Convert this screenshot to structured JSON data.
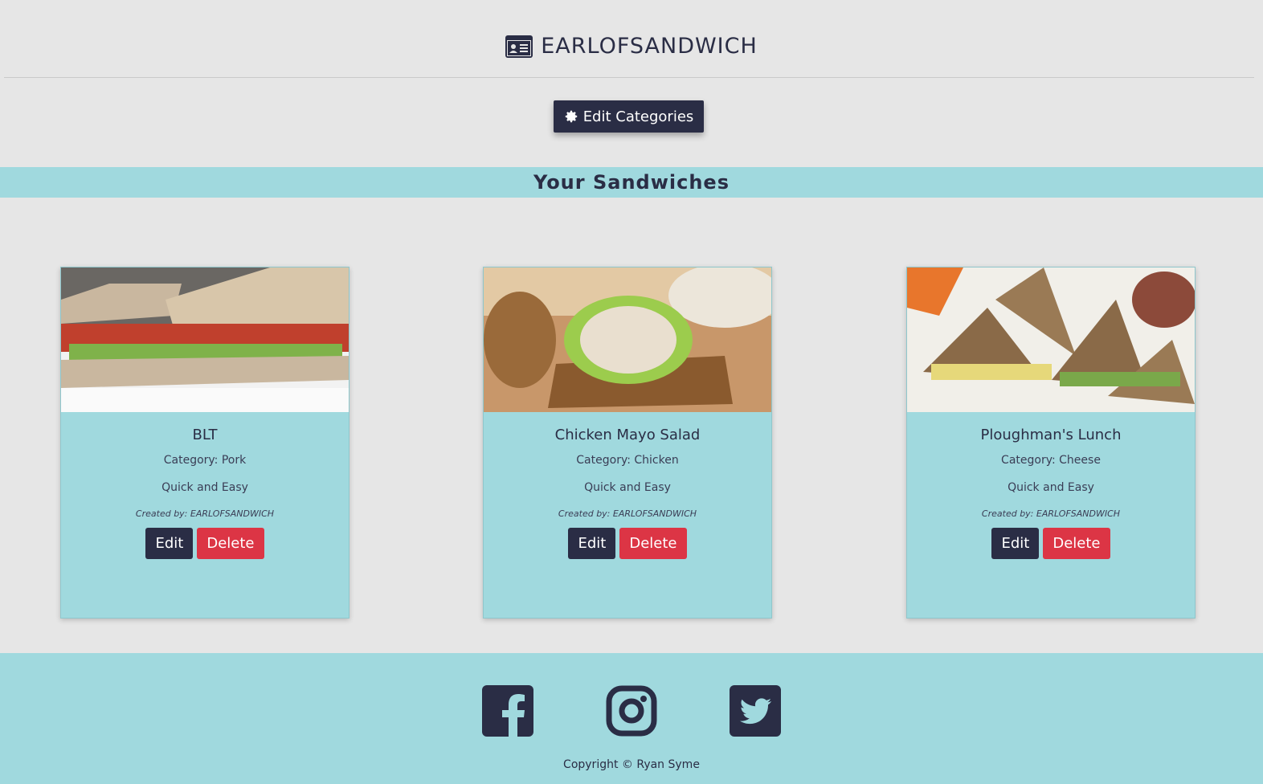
{
  "header": {
    "title": "EARLOFSANDWICH",
    "icon": "id-card-icon"
  },
  "actions": {
    "edit_categories_label": "Edit Categories",
    "edit_categories_icon": "gear-icon"
  },
  "section": {
    "title": "Your Sandwiches"
  },
  "sandwiches": [
    {
      "name": "BLT",
      "category": "Category: Pork",
      "time": "Quick and Easy",
      "created_by": "Created by: EARLOFSANDWICH",
      "edit_label": "Edit",
      "delete_label": "Delete"
    },
    {
      "name": "Chicken Mayo Salad",
      "category": "Category: Chicken",
      "time": "Quick and Easy",
      "created_by": "Created by: EARLOFSANDWICH",
      "edit_label": "Edit",
      "delete_label": "Delete"
    },
    {
      "name": "Ploughman's Lunch",
      "category": "Category: Cheese",
      "time": "Quick and Easy",
      "created_by": "Created by: EARLOFSANDWICH",
      "edit_label": "Edit",
      "delete_label": "Delete"
    }
  ],
  "footer": {
    "social": [
      "facebook-icon",
      "instagram-icon",
      "twitter-icon"
    ],
    "copyright": "Copyright © Ryan Syme"
  },
  "colors": {
    "primary": "#2a2d45",
    "accent": "#a0d9de",
    "danger": "#dc3545",
    "background": "#e6e6e6"
  }
}
